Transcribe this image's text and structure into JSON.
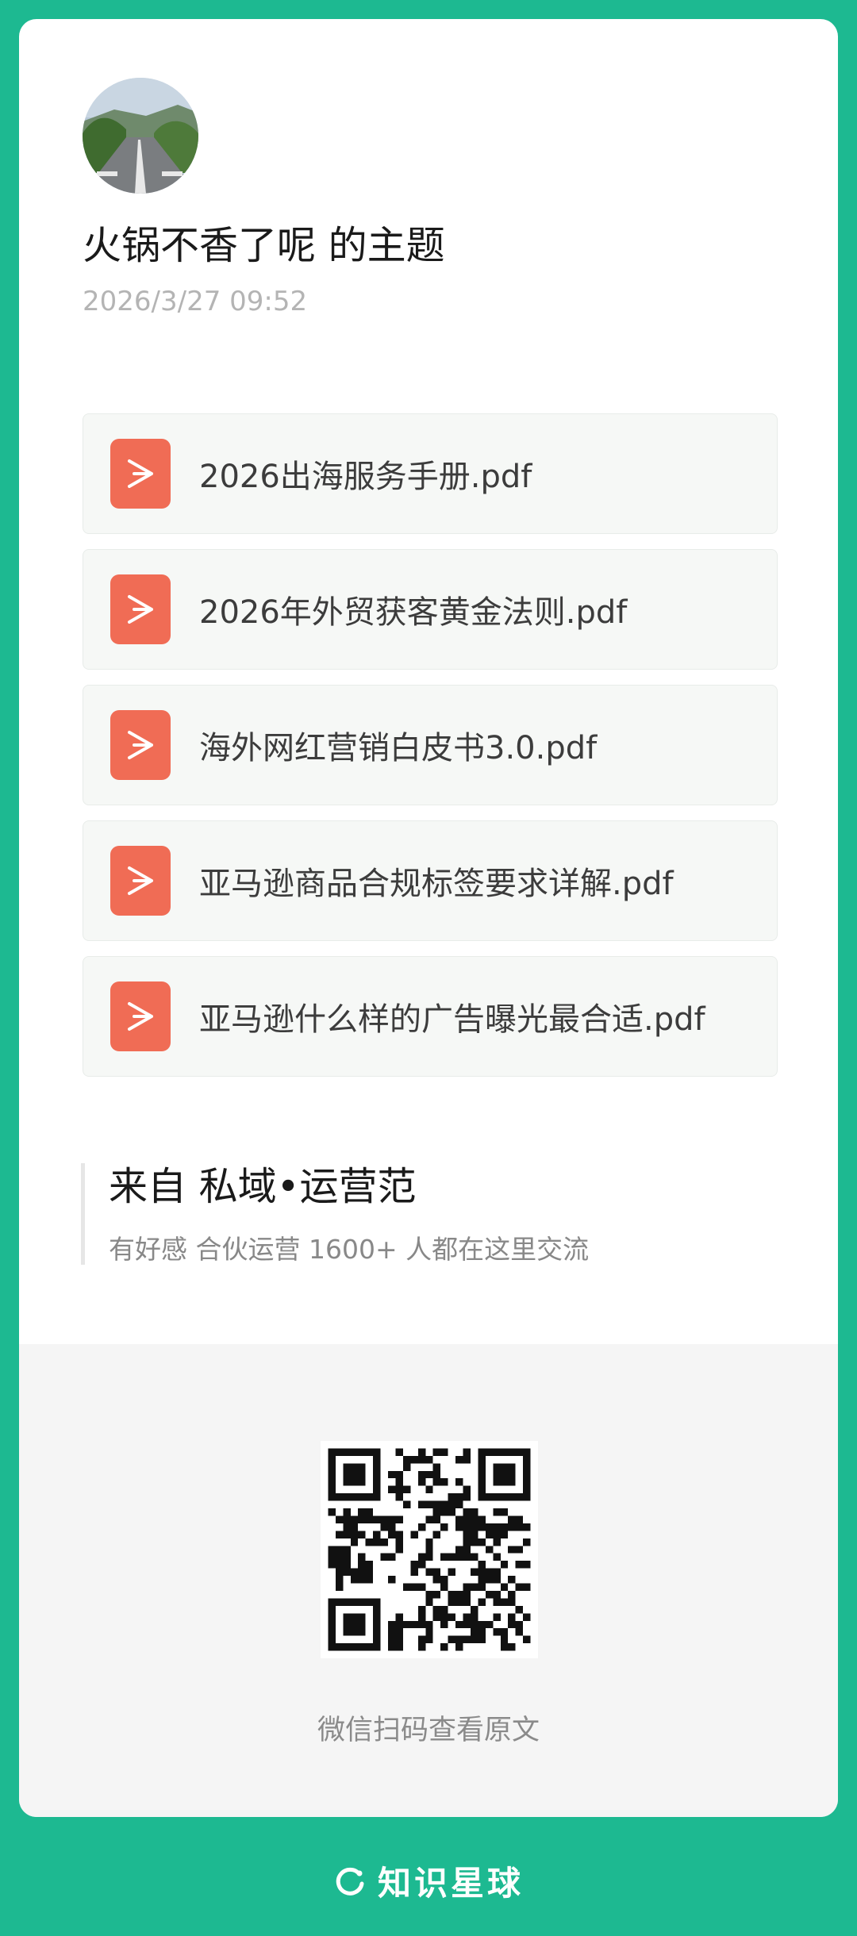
{
  "post": {
    "title": "火锅不香了呢 的主题",
    "date": "2026/3/27 09:52",
    "avatar_icon": "road-landscape-avatar"
  },
  "files": [
    {
      "name": "2026出海服务手册.pdf",
      "icon": "pdf-icon"
    },
    {
      "name": "2026年外贸获客黄金法则.pdf",
      "icon": "pdf-icon"
    },
    {
      "name": "海外网红营销白皮书3.0.pdf",
      "icon": "pdf-icon"
    },
    {
      "name": "亚马逊商品合规标签要求详解.pdf",
      "icon": "pdf-icon"
    },
    {
      "name": "亚马逊什么样的广告曝光最合适.pdf",
      "icon": "pdf-icon"
    }
  ],
  "source": {
    "title": "来自 私域•运营范",
    "subtitle": "有好感 合伙运营 1600+ 人都在这里交流"
  },
  "qr": {
    "caption": "微信扫码查看原文"
  },
  "brand": {
    "name": "知识星球",
    "icon": "zsxq-logo-icon"
  },
  "colors": {
    "background": "#1db991",
    "pdf_icon": "#f06c55",
    "card": "#ffffff"
  }
}
